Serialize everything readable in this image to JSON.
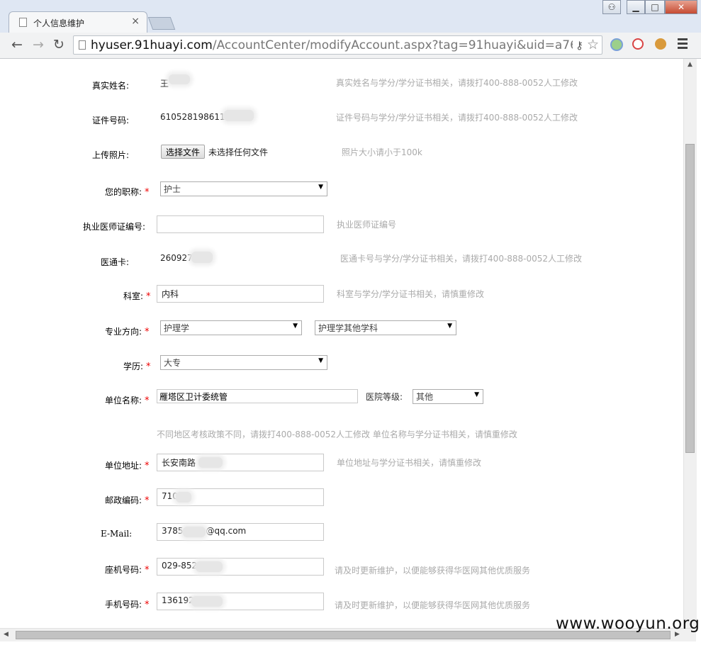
{
  "browser": {
    "tab_title": "个人信息维护",
    "tab_close": "×",
    "url_host": "hyuser.91huayi.com",
    "url_path": "/AccountCenter/modifyAccount.aspx?tag=91huayi&uid=a76d78e8-9",
    "win_buttons": {
      "user": "⚇",
      "minimize": "▁",
      "maximize": "□",
      "close": "✕"
    }
  },
  "form": {
    "real_name": {
      "label": "真实姓名:",
      "value": "王",
      "hint": "真实姓名与学分/学分证书相关，请拨打400-888-0052人工修改"
    },
    "id_number": {
      "label": "证件号码:",
      "value": "6105281986110",
      "hint": "证件号码与学分/学分证书相关，请拨打400-888-0052人工修改"
    },
    "photo": {
      "label": "上传照片:",
      "button": "选择文件",
      "status": "未选择任何文件",
      "hint": "照片大小请小于100k"
    },
    "title": {
      "label": "您的职称:",
      "selected": "护士"
    },
    "license": {
      "label": "执业医师证编号:",
      "value": "",
      "hint": "执业医师证编号"
    },
    "card": {
      "label": "医通卡:",
      "value": "260927",
      "hint": "医通卡号与学分/学分证书相关，请拨打400-888-0052人工修改"
    },
    "department": {
      "label": "科室:",
      "value": "内科",
      "hint": "科室与学分/学分证书相关，请慎重修改"
    },
    "specialty": {
      "label": "专业方向:",
      "selected_main": "护理学",
      "selected_sub": "护理学其他学科"
    },
    "education": {
      "label": "学历:",
      "selected": "大专"
    },
    "employer": {
      "label": "单位名称:",
      "value": "雁塔区卫计委统管",
      "level_label": "医院等级:",
      "level_selected": "其他",
      "note": "不同地区考核政策不同，请拨打400-888-0052人工修改  单位名称与学分证书相关，请慎重修改"
    },
    "address": {
      "label": "单位地址:",
      "value": "长安南路",
      "hint": "单位地址与学分证书相关，请慎重修改"
    },
    "postcode": {
      "label": "邮政编码:",
      "value": "710"
    },
    "email": {
      "label": "E-Mail:",
      "value_prefix": "3785",
      "value_suffix": "@qq.com"
    },
    "landline": {
      "label": "座机号码:",
      "value": "029-852",
      "hint": "请及时更新维护，以便能够获得华医网其他优质服务"
    },
    "mobile": {
      "label": "手机号码:",
      "value": "136192",
      "hint": "请及时更新维护，以便能够获得华医网其他优质服务"
    },
    "required_mark": "*"
  },
  "watermark": "www.wooyun.org"
}
